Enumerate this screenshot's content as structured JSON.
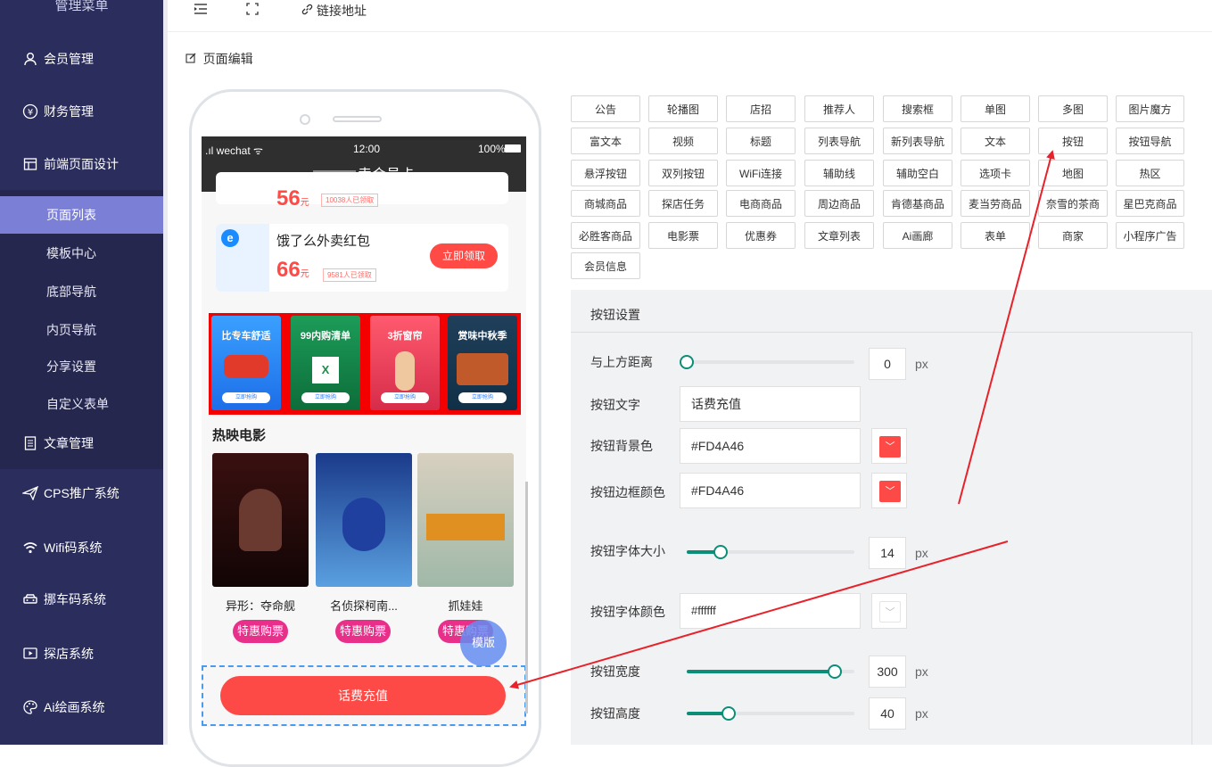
{
  "sidebar": {
    "title": "管理菜单",
    "items": [
      {
        "label": "会员管理",
        "icon": "user-icon"
      },
      {
        "label": "财务管理",
        "icon": "yen-icon"
      },
      {
        "label": "前端页面设计",
        "icon": "layout-icon"
      },
      {
        "label": "文章管理",
        "icon": "document-icon"
      },
      {
        "label": "CPS推广系统",
        "icon": "send-icon"
      },
      {
        "label": "Wifi码系统",
        "icon": "wifi-icon"
      },
      {
        "label": "挪车码系统",
        "icon": "car-icon"
      },
      {
        "label": "探店系统",
        "icon": "play-icon"
      },
      {
        "label": "Ai绘画系统",
        "icon": "palette-icon"
      }
    ],
    "subitems": [
      "页面列表",
      "模板中心",
      "底部导航",
      "内页导航",
      "分享设置",
      "自定义表单"
    ],
    "active_sub": "页面列表"
  },
  "topbar": {
    "link_label": "链接地址"
  },
  "breadcrumb": "页面编辑",
  "phone": {
    "carrier": ".ıl wechat ᯤ",
    "time": "12:00",
    "battery": "100%",
    "title": "卖会员卡",
    "coupon_prev": {
      "amount": "56",
      "unit": "元",
      "tag": "10038人已领取"
    },
    "coupon": {
      "name": "饿了么外卖红包",
      "amount": "66",
      "unit": "元",
      "tag": "9581人已领取",
      "button": "立即领取"
    },
    "banners": [
      {
        "title": "比专车舒适",
        "button": "立即抢购"
      },
      {
        "title": "99内购清单",
        "button": "立即抢购"
      },
      {
        "title": "3折窗帘",
        "button": "立即抢购"
      },
      {
        "title": "赏味中秋季",
        "button": "立即抢购"
      }
    ],
    "movies_title": "热映电影",
    "movies": [
      {
        "name": "异形：夺命舰",
        "button": "特惠购票"
      },
      {
        "name": "名侦探柯南...",
        "button": "特惠购票"
      },
      {
        "name": "抓娃娃",
        "button": "特惠购票"
      }
    ],
    "template_float": "模版",
    "main_button": "话费充值"
  },
  "components": [
    "公告",
    "轮播图",
    "店招",
    "推荐人",
    "搜索框",
    "单图",
    "多图",
    "图片魔方",
    "富文本",
    "视频",
    "标题",
    "列表导航",
    "新列表导航",
    "文本",
    "按钮",
    "按钮导航",
    "悬浮按钮",
    "双列按钮",
    "WiFi连接",
    "辅助线",
    "辅助空白",
    "选项卡",
    "地图",
    "热区",
    "商城商品",
    "探店任务",
    "电商商品",
    "周边商品",
    "肯德基商品",
    "麦当劳商品",
    "奈雪的茶商",
    "星巴克商品",
    "必胜客商品",
    "电影票",
    "优惠券",
    "文章列表",
    "Ai画廊",
    "表单",
    "商家",
    "小程序广告",
    "会员信息"
  ],
  "settings": {
    "title": "按钮设置",
    "top_margin": {
      "label": "与上方距离",
      "value": "0",
      "unit": "px",
      "level": 0
    },
    "text": {
      "label": "按钮文字",
      "value": "话费充值"
    },
    "bg_color": {
      "label": "按钮背景色",
      "value": "#FD4A46"
    },
    "border_color": {
      "label": "按钮边框颜色",
      "value": "#FD4A46"
    },
    "font_size": {
      "label": "按钮字体大小",
      "value": "14",
      "unit": "px",
      "level": 0.2
    },
    "font_color": {
      "label": "按钮字体颜色",
      "value": "#ffffff"
    },
    "width": {
      "label": "按钮宽度",
      "value": "300",
      "unit": "px",
      "level": 0.88
    },
    "height": {
      "label": "按钮高度",
      "value": "40",
      "unit": "px",
      "level": 0.25
    }
  },
  "colors": {
    "accent": "#0b8e78",
    "brand_red": "#fd4a46",
    "sidebar_bg": "#2b2d5c",
    "active_sub": "#7b7fd6",
    "arrow": "#e8212a"
  }
}
